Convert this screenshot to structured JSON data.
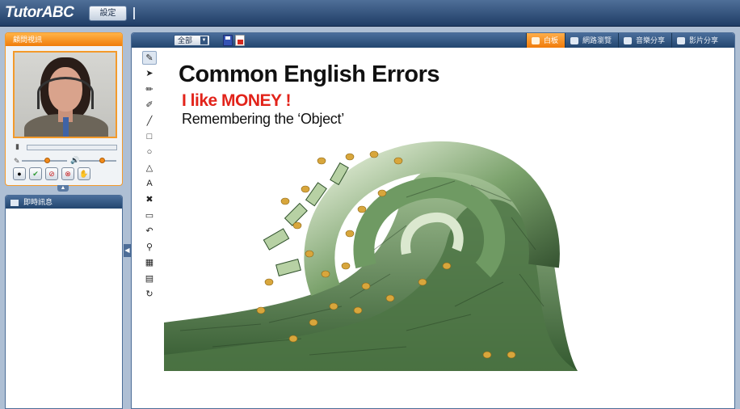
{
  "app": {
    "logo_text": "TutorABC",
    "settings_label": "設定"
  },
  "video_panel": {
    "title": "顧問視訊",
    "volume_level": 0.0,
    "mic_level": 0.55,
    "speaker_level": 0.6
  },
  "chat_panel": {
    "title": "即時訊息"
  },
  "main_header": {
    "scope_label": "全部",
    "tabs": [
      {
        "label": "白板",
        "active": true
      },
      {
        "label": "網路瀏覽",
        "active": false
      },
      {
        "label": "音樂分享",
        "active": false
      },
      {
        "label": "影片分享",
        "active": false
      }
    ]
  },
  "draw_tools": [
    {
      "icon": "paint-brush-icon",
      "glyph": "✎"
    },
    {
      "icon": "pointer-arrow-icon",
      "glyph": "➤"
    },
    {
      "icon": "marker-icon",
      "glyph": "✏"
    },
    {
      "icon": "highlighter-icon",
      "glyph": "✐"
    },
    {
      "icon": "line-icon",
      "glyph": "╱"
    },
    {
      "icon": "rectangle-icon",
      "glyph": "□"
    },
    {
      "icon": "ellipse-icon",
      "glyph": "○"
    },
    {
      "icon": "triangle-icon",
      "glyph": "△"
    },
    {
      "icon": "text-tool-icon",
      "glyph": "A"
    },
    {
      "icon": "delete-icon",
      "glyph": "✖"
    },
    {
      "icon": "eraser-icon",
      "glyph": "▭"
    },
    {
      "icon": "undo-icon",
      "glyph": "↶"
    },
    {
      "icon": "zoom-icon",
      "glyph": "⚲"
    },
    {
      "icon": "image-icon",
      "glyph": "▦"
    },
    {
      "icon": "page-icon",
      "glyph": "▤"
    },
    {
      "icon": "refresh-icon",
      "glyph": "↻"
    }
  ],
  "slide": {
    "title": "Common English Errors",
    "subtitle": "I like MONEY !",
    "subtitle2": "Remembering the ‘Object’"
  },
  "colors": {
    "accent": "#f07c0a",
    "header_blue": "#23466f",
    "red": "#e2231a"
  }
}
